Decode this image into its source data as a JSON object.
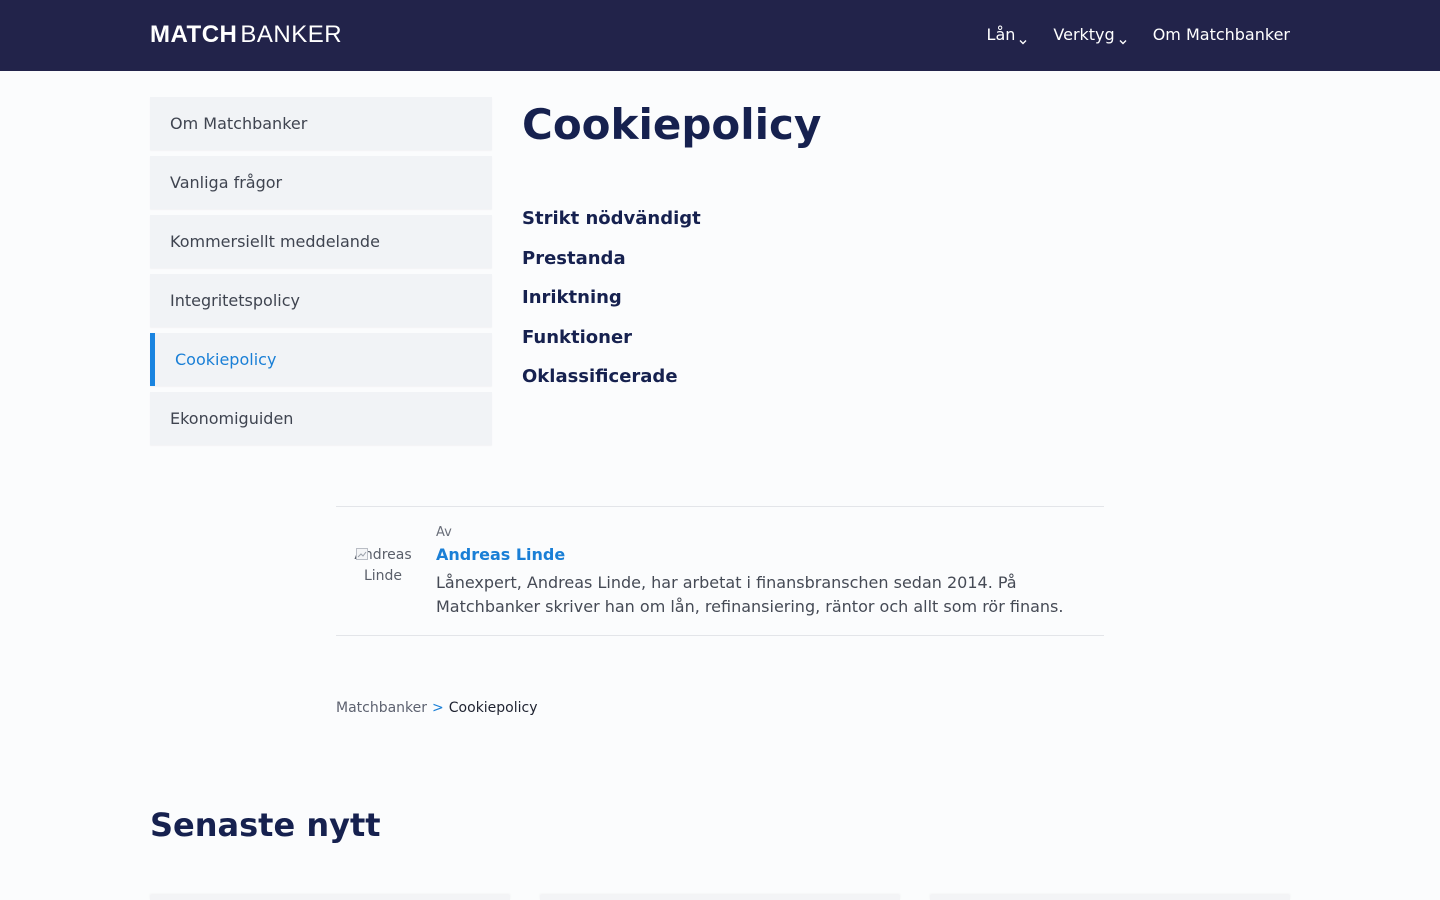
{
  "header": {
    "logo_bold": "MATCH",
    "logo_light": "BANKER",
    "nav": [
      {
        "label": "Lån",
        "icon": "chevron-down-icon"
      },
      {
        "label": "Verktyg",
        "icon": "chevron-down-icon"
      },
      {
        "label": "Om Matchbanker"
      }
    ]
  },
  "sidebar": {
    "items": [
      {
        "label": "Om Matchbanker"
      },
      {
        "label": "Vanliga frågor"
      },
      {
        "label": "Kommersiellt meddelande"
      },
      {
        "label": "Integritetspolicy"
      },
      {
        "label": "Cookiepolicy",
        "active": true
      },
      {
        "label": "Ekonomiguiden"
      }
    ]
  },
  "main": {
    "title": "Cookiepolicy",
    "sections": [
      "Strikt nödvändigt",
      "Prestanda",
      "Inriktning",
      "Funktioner",
      "Oklassificerade"
    ]
  },
  "author": {
    "by_label": "Av",
    "name": "Andreas Linde",
    "avatar_alt": "Andreas Linde",
    "bio": "Lånexpert, Andreas Linde, har arbetat i finansbranschen sedan 2014. På Matchbanker skriver han om lån, refinansiering, räntor och allt som rör finans."
  },
  "breadcrumb": {
    "home": "Matchbanker",
    "separator": ">",
    "current": "Cookiepolicy"
  },
  "latest": {
    "title": "Senaste nytt"
  },
  "colors": {
    "header_bg": "#22234a",
    "heading": "#16214f",
    "accent": "#1a7fd6",
    "sidebar_bg": "#f1f3f6"
  }
}
